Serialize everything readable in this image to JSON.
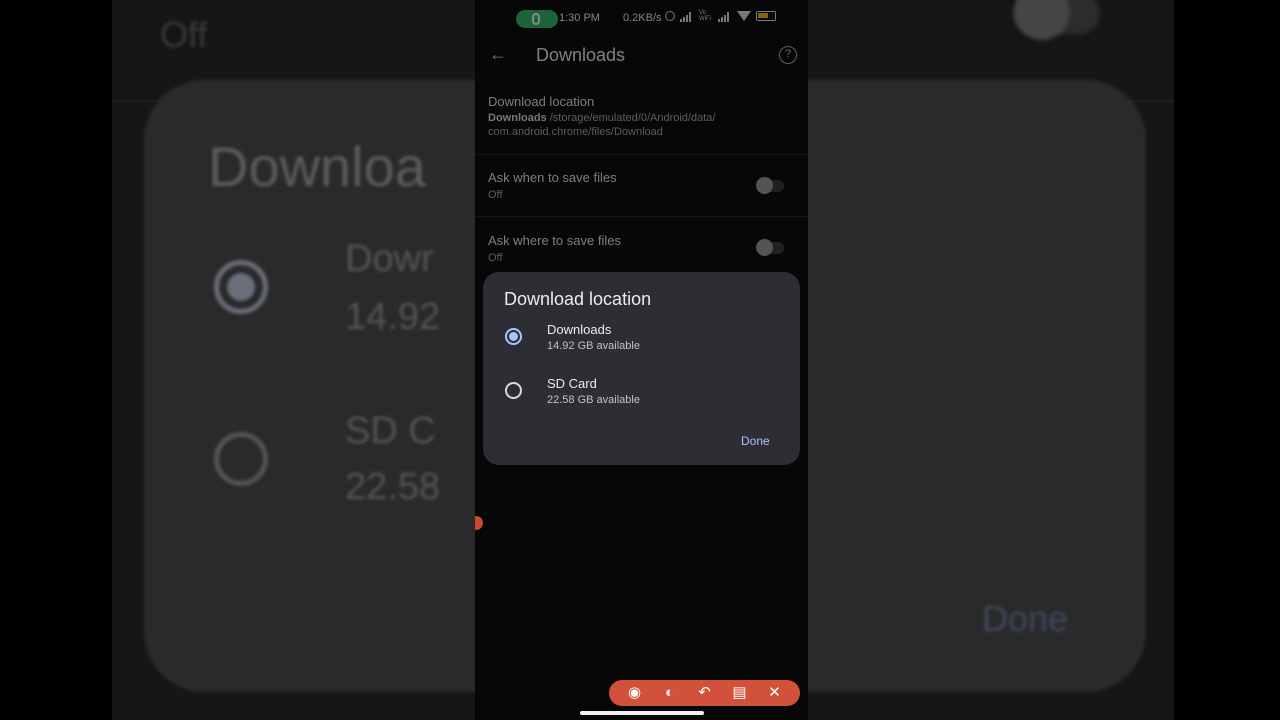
{
  "background": {
    "off_label": "Off",
    "title": "Downloa",
    "option1_name": "Dowr",
    "option1_sub": "14.92",
    "option2_name": "SD C",
    "option2_sub": "22.58",
    "done": "Done"
  },
  "status_bar": {
    "time": "1:30 PM",
    "speed": "0.2KB/s",
    "vowifi": "Vo WiFi"
  },
  "app_bar": {
    "title": "Downloads",
    "back_icon": "arrow-left-icon",
    "help_icon": "help-circle-icon"
  },
  "settings": {
    "download_location": {
      "title": "Download location",
      "folder": "Downloads",
      "path_line1": " /storage/emulated/0/Android/data/",
      "path_line2": "com.android.chrome/files/Download"
    },
    "ask_when": {
      "title": "Ask when to save files",
      "sub": "Off"
    },
    "ask_where": {
      "title": "Ask where to save files",
      "sub": "Off"
    }
  },
  "dialog": {
    "title": "Download location",
    "options": [
      {
        "name": "Downloads",
        "sub": "14.92 GB available",
        "selected": true
      },
      {
        "name": "SD Card",
        "sub": "22.58 GB available",
        "selected": false
      }
    ],
    "done_label": "Done",
    "accent": "#a8c3ff"
  },
  "toolbar": {
    "icons": [
      "camera-icon",
      "palette-icon",
      "undo-icon",
      "trash-icon",
      "close-icon"
    ],
    "color": "#d2513a"
  }
}
